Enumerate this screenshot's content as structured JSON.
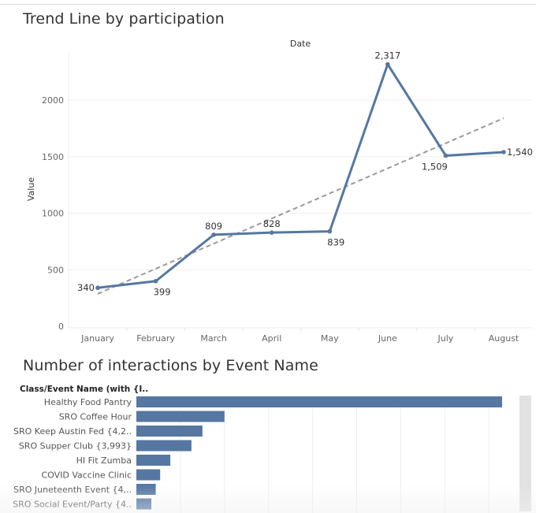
{
  "colors": {
    "series": "#5577a2",
    "trend": "#9a9a9a",
    "grid": "#efefef",
    "scrollbar": "#e2e2e2"
  },
  "chart_data": [
    {
      "type": "line",
      "title": "Trend Line by participation",
      "xlabel": "Date",
      "ylabel": "Value",
      "x_axis_position": "top-title",
      "categories": [
        "January",
        "February",
        "March",
        "April",
        "May",
        "June",
        "July",
        "August"
      ],
      "series": [
        {
          "name": "Value",
          "values": [
            340,
            399,
            809,
            828,
            839,
            2317,
            1509,
            1540
          ],
          "labels": [
            "340",
            "399",
            "809",
            "828",
            "839",
            "2,317",
            "1,509",
            "1,540"
          ]
        }
      ],
      "trend_line": {
        "type": "linear",
        "start": 287,
        "end": 1840,
        "style": "dashed"
      },
      "yticks": [
        0,
        500,
        1000,
        1500,
        2000
      ],
      "ytick_labels": [
        "0",
        "500",
        "1000",
        "1500",
        "2000"
      ],
      "ylim": [
        0,
        2300
      ],
      "grid": true,
      "legend": "none"
    },
    {
      "type": "bar",
      "orientation": "horizontal",
      "title": "Number of interactions by Event Name",
      "row_header": "Class/Event Name (with {I..",
      "categories": [
        "Healthy Food Pantry",
        "SRO Coffee Hour",
        "SRO Keep Austin Fed {4,2..",
        "SRO Supper Club {3,993}",
        "HI Fit Zumba",
        "COVID Vaccine Clinic",
        "SRO Juneteenth Event {4,..",
        "SRO Social Event/Party {4.."
      ],
      "values": [
        8.3,
        2.0,
        1.5,
        1.25,
        0.77,
        0.54,
        0.44,
        0.34
      ],
      "value_units": "gridline intervals (axis not labeled)",
      "grid_intervals": 8,
      "grid": true,
      "legend": "none",
      "scrollable": true
    }
  ]
}
